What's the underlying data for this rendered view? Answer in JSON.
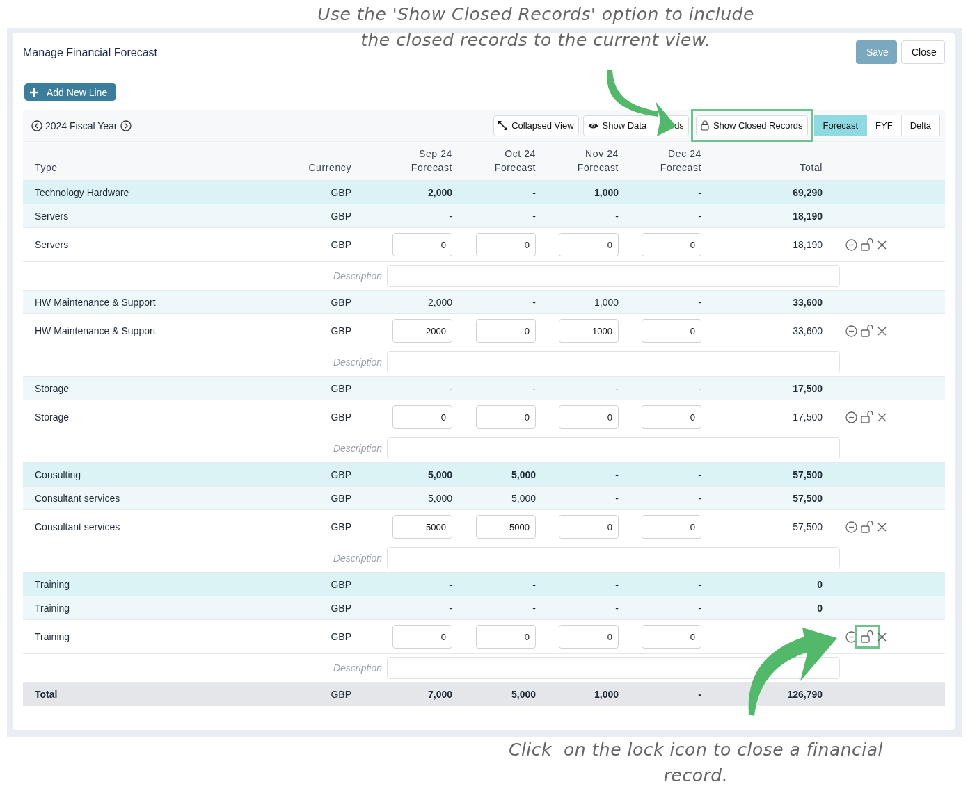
{
  "annotations": [
    {
      "text": "Use the 'Show Closed Records' option to include the closed records to the current view.",
      "kind": "top"
    },
    {
      "text": "Click  on the lock icon to close a financial record.",
      "kind": "bottom"
    }
  ],
  "title": "Manage Financial Forecast",
  "buttons": [
    {
      "label": "Save",
      "kind": "primary"
    },
    {
      "label": "Close",
      "kind": "secondary"
    }
  ],
  "add_button": "Add New Line",
  "fiscal_year": "2024 Fiscal Year",
  "toolbar_buttons": [
    {
      "label_parts": [
        "Collapsed View"
      ],
      "kind": "collapse",
      "highlighted": false
    },
    {
      "label_parts": [
        "Show Data",
        "ds"
      ],
      "kind": "eye",
      "highlighted": false
    },
    {
      "label_parts": [
        "Show Closed Records"
      ],
      "kind": "lock",
      "highlighted": true
    }
  ],
  "view_tabs": [
    {
      "label": "Forecast",
      "selected": true
    },
    {
      "label": "FYF",
      "selected": false
    },
    {
      "label": "Delta",
      "selected": false
    }
  ],
  "table": {
    "columns": [
      {
        "lines": [
          "Type"
        ]
      },
      {
        "lines": [
          "Currency"
        ]
      },
      {
        "lines": [
          "Sep 24",
          "Forecast"
        ]
      },
      {
        "lines": [
          "Oct 24",
          "Forecast"
        ]
      },
      {
        "lines": [
          "Nov 24",
          "Forecast"
        ]
      },
      {
        "lines": [
          "Dec 24",
          "Forecast"
        ]
      },
      {
        "lines": [
          "Total"
        ]
      }
    ],
    "rows": [
      {
        "kind": "group",
        "type": "Technology Hardware",
        "currency": "GBP",
        "values": [
          "2,000",
          "-",
          "1,000",
          "-"
        ],
        "total": "69,290"
      },
      {
        "kind": "sub",
        "type": "Servers",
        "currency": "GBP",
        "values": [
          "-",
          "-",
          "-",
          "-"
        ],
        "total": "18,190"
      },
      {
        "kind": "edit",
        "type": "Servers",
        "currency": "GBP",
        "values": [
          "0",
          "0",
          "0",
          "0"
        ],
        "total": "18,190",
        "locked": false,
        "lock_highlighted": false
      },
      {
        "kind": "description",
        "label": "Description"
      },
      {
        "kind": "sub",
        "type": "HW Maintenance & Support",
        "currency": "GBP",
        "values": [
          "2,000",
          "-",
          "1,000",
          "-"
        ],
        "total": "33,600"
      },
      {
        "kind": "edit",
        "type": "HW Maintenance & Support",
        "currency": "GBP",
        "values": [
          "2000",
          "0",
          "1000",
          "0"
        ],
        "total": "33,600",
        "locked": false,
        "lock_highlighted": false
      },
      {
        "kind": "description",
        "label": "Description"
      },
      {
        "kind": "sub",
        "type": "Storage",
        "currency": "GBP",
        "values": [
          "-",
          "-",
          "-",
          "-"
        ],
        "total": "17,500"
      },
      {
        "kind": "edit",
        "type": "Storage",
        "currency": "GBP",
        "values": [
          "0",
          "0",
          "0",
          "0"
        ],
        "total": "17,500",
        "locked": false,
        "lock_highlighted": false
      },
      {
        "kind": "description",
        "label": "Description"
      },
      {
        "kind": "group",
        "type": "Consulting",
        "currency": "GBP",
        "values": [
          "5,000",
          "5,000",
          "-",
          "-"
        ],
        "total": "57,500"
      },
      {
        "kind": "sub",
        "type": "Consultant services",
        "currency": "GBP",
        "values": [
          "5,000",
          "5,000",
          "-",
          "-"
        ],
        "total": "57,500"
      },
      {
        "kind": "edit",
        "type": "Consultant services",
        "currency": "GBP",
        "values": [
          "5000",
          "5000",
          "0",
          "0"
        ],
        "total": "57,500",
        "locked": false,
        "lock_highlighted": false
      },
      {
        "kind": "description",
        "label": "Description"
      },
      {
        "kind": "group",
        "type": "Training",
        "currency": "GBP",
        "values": [
          "-",
          "-",
          "-",
          "-"
        ],
        "total": "0"
      },
      {
        "kind": "sub",
        "type": "Training",
        "currency": "GBP",
        "values": [
          "-",
          "-",
          "-",
          "-"
        ],
        "total": "0"
      },
      {
        "kind": "edit",
        "type": "Training",
        "currency": "GBP",
        "values": [
          "0",
          "0",
          "0",
          "0"
        ],
        "locked": false,
        "lock_highlighted": true
      },
      {
        "kind": "description",
        "label": "Description"
      },
      {
        "kind": "total",
        "type": "Total",
        "currency": "GBP",
        "values": [
          "7,000",
          "5,000",
          "1,000",
          "-"
        ],
        "total": "126,790"
      }
    ]
  }
}
